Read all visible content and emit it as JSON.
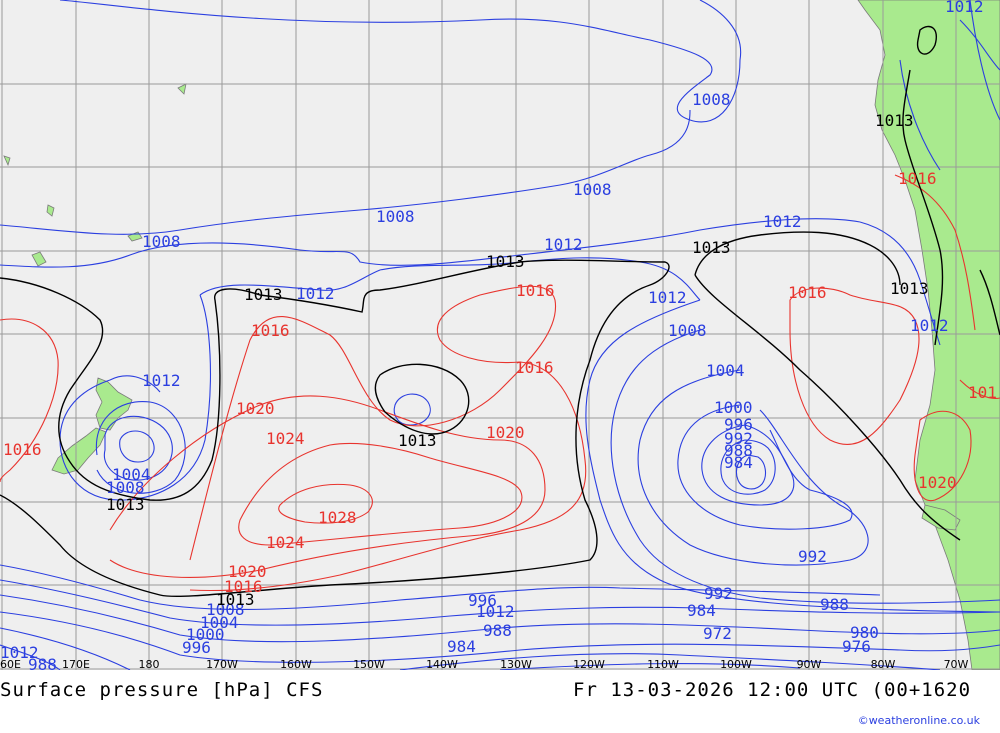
{
  "colors": {
    "ocean": "#efefef",
    "land": "#a9ea8e",
    "isobar_low": "#2b3fe0",
    "isobar_high": "#e8342e",
    "isobar_ref": "#000000",
    "grid": "#9a9a9a"
  },
  "caption": {
    "product": "Surface pressure [hPa] CFS",
    "valid_time": "Fr 13-03-2026 12:00 UTC (00+1620"
  },
  "credit": "©weatheronline.co.uk",
  "longitude_ticks": [
    "60E",
    "170E",
    "180",
    "170W",
    "160W",
    "150W",
    "140W",
    "130W",
    "120W",
    "110W",
    "100W",
    "90W",
    "80W",
    "70W"
  ],
  "isobar_labels": {
    "blue": [
      "1012",
      "1008",
      "1008",
      "1008",
      "1008",
      "1012",
      "1012",
      "1012",
      "1012",
      "1012",
      "1008",
      "1004",
      "1000",
      "996",
      "992",
      "988",
      "984",
      "1004",
      "1008",
      "1012",
      "992",
      "996",
      "988",
      "992",
      "988",
      "984",
      "972",
      "980",
      "976",
      "988",
      "984",
      "1000",
      "1004",
      "1008",
      "996",
      "1012",
      "1012",
      "1012"
    ],
    "red": [
      "1016",
      "1016",
      "1016",
      "1016",
      "1020",
      "1024",
      "1028",
      "1024",
      "1020",
      "1016",
      "1020",
      "1016",
      "1016",
      "1020",
      "1016",
      "1016",
      "101"
    ],
    "black": [
      "1013",
      "1013",
      "1013",
      "1013",
      "1013",
      "1013",
      "1013",
      "1013"
    ]
  }
}
